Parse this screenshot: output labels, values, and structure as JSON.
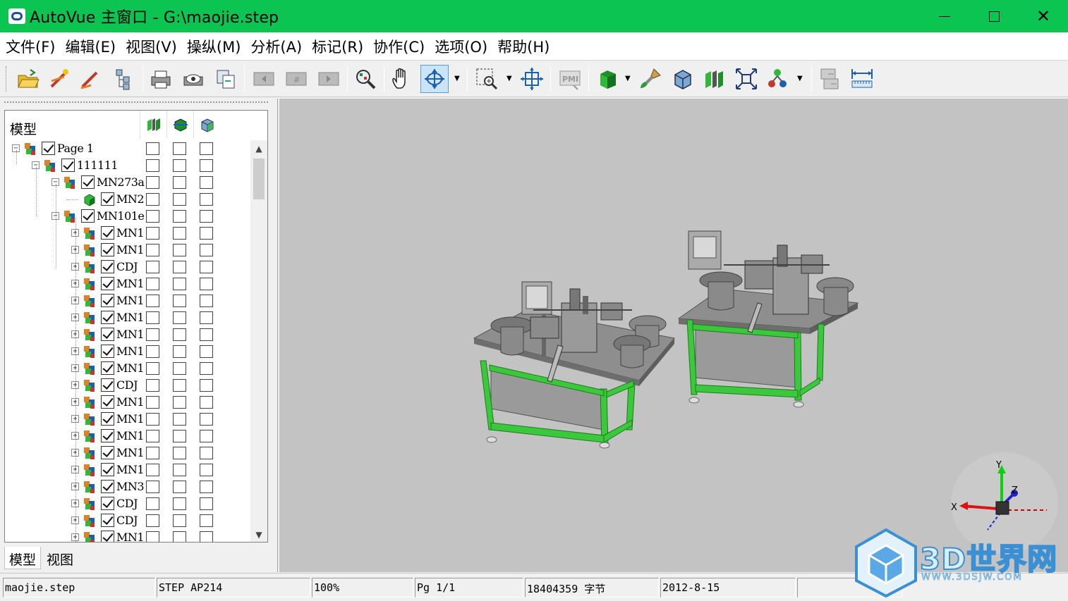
{
  "window": {
    "title": "AutoVue 主窗口 - G:\\maojie.step"
  },
  "menu": [
    "文件(F)",
    "编辑(E)",
    "视图(V)",
    "操纵(M)",
    "分析(A)",
    "标记(R)",
    "协作(C)",
    "选项(O)",
    "帮助(H)"
  ],
  "toolbar": {
    "icons": [
      "open-folder-icon",
      "markup-icon",
      "markup-edit-icon",
      "tree-structure-icon",
      "print-icon",
      "print-preview-icon",
      "copy-icon",
      "prev-page-icon",
      "page-icon",
      "next-page-icon",
      "zoom-fit-icon",
      "pan-hand-icon",
      "rotate-icon",
      "zoom-window-icon",
      "fit-view-icon",
      "pmi-icon",
      "shaded-icon",
      "paint-brush-icon",
      "wireframe-icon",
      "section-icon",
      "explode-icon",
      "attributes-icon",
      "compare-icon",
      "measure-icon"
    ],
    "rotate_pressed": true
  },
  "tree": {
    "header_label": "模型",
    "header_icons": [
      "visibility-icon",
      "transparency-icon",
      "box-icon"
    ],
    "rows": [
      {
        "label": "Page 1",
        "level": 0,
        "toggle": "⊟",
        "checked": true,
        "icon": "assembly-icon"
      },
      {
        "label": "111111",
        "level": 1,
        "toggle": "⊟",
        "checked": true,
        "icon": "assembly-icon"
      },
      {
        "label": "MN273a",
        "level": 2,
        "toggle": "⊟",
        "checked": true,
        "icon": "assembly-icon"
      },
      {
        "label": "MN2",
        "level": 3,
        "toggle": "",
        "checked": true,
        "icon": "part-icon"
      },
      {
        "label": "MN101e",
        "level": 2,
        "toggle": "⊟",
        "checked": true,
        "icon": "assembly-icon"
      },
      {
        "label": "MN1",
        "level": 3,
        "toggle": "+",
        "checked": true,
        "icon": "assembly-icon"
      },
      {
        "label": "MN1",
        "level": 3,
        "toggle": "+",
        "checked": true,
        "icon": "assembly-icon"
      },
      {
        "label": "CDJ",
        "level": 3,
        "toggle": "+",
        "checked": true,
        "icon": "assembly-icon"
      },
      {
        "label": "MN1",
        "level": 3,
        "toggle": "+",
        "checked": true,
        "icon": "assembly-icon"
      },
      {
        "label": "MN1",
        "level": 3,
        "toggle": "+",
        "checked": true,
        "icon": "assembly-icon"
      },
      {
        "label": "MN1",
        "level": 3,
        "toggle": "+",
        "checked": true,
        "icon": "assembly-icon"
      },
      {
        "label": "MN1",
        "level": 3,
        "toggle": "+",
        "checked": true,
        "icon": "assembly-icon"
      },
      {
        "label": "MN1",
        "level": 3,
        "toggle": "+",
        "checked": true,
        "icon": "assembly-icon"
      },
      {
        "label": "MN1",
        "level": 3,
        "toggle": "+",
        "checked": true,
        "icon": "assembly-icon"
      },
      {
        "label": "CDJ",
        "level": 3,
        "toggle": "+",
        "checked": true,
        "icon": "assembly-icon"
      },
      {
        "label": "MN1",
        "level": 3,
        "toggle": "+",
        "checked": true,
        "icon": "assembly-icon"
      },
      {
        "label": "MN1",
        "level": 3,
        "toggle": "+",
        "checked": true,
        "icon": "assembly-icon"
      },
      {
        "label": "MN1",
        "level": 3,
        "toggle": "+",
        "checked": true,
        "icon": "assembly-icon"
      },
      {
        "label": "MN1",
        "level": 3,
        "toggle": "+",
        "checked": true,
        "icon": "assembly-icon"
      },
      {
        "label": "MN1",
        "level": 3,
        "toggle": "+",
        "checked": true,
        "icon": "assembly-icon"
      },
      {
        "label": "MN3",
        "level": 3,
        "toggle": "+",
        "checked": true,
        "icon": "assembly-icon"
      },
      {
        "label": "CDJ",
        "level": 3,
        "toggle": "+",
        "checked": true,
        "icon": "assembly-icon"
      },
      {
        "label": "CDJ",
        "level": 3,
        "toggle": "+",
        "checked": true,
        "icon": "assembly-icon"
      },
      {
        "label": "MN1",
        "level": 3,
        "toggle": "+",
        "checked": true,
        "icon": "assembly-icon"
      }
    ]
  },
  "panel_tabs": {
    "model": "模型",
    "view": "视图"
  },
  "axes": {
    "x": "X",
    "y": "Y",
    "z": "Z"
  },
  "status": {
    "file": "maojie.step",
    "format": "STEP AP214",
    "zoom": "100%",
    "page": "Pg 1/1",
    "size": "18404359 字节",
    "date": "2012-8-15",
    "extra": ""
  },
  "watermark": {
    "title": "3D世界网",
    "url": "WWW.3DSJW.COM"
  },
  "colors": {
    "titlebar": "#0cc451",
    "viewport_bg": "#c3c3c3",
    "frame_green": "#3cc83c"
  }
}
